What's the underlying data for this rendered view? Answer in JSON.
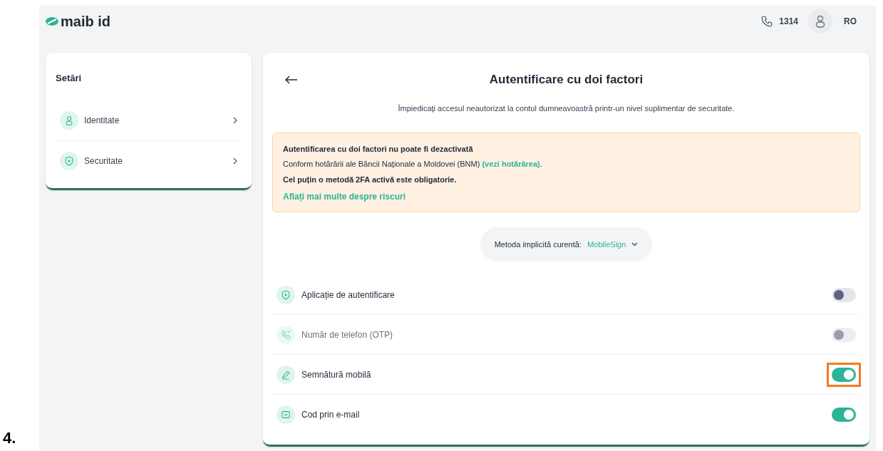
{
  "step_label": "4.",
  "header": {
    "logo": "maib id",
    "phone": "1314",
    "language": "RO"
  },
  "sidebar": {
    "title": "Setări",
    "items": [
      {
        "label": "Identitate",
        "kind": "person"
      },
      {
        "label": "Securitate",
        "kind": "shield"
      }
    ]
  },
  "main": {
    "title": "Autentificare cu doi factori",
    "subtitle": "Împiedicați accesul neautorizat la contul dumneavoastră printr-un nivel suplimentar de securitate.",
    "alert": {
      "title": "Autentificarea cu doi factori nu poate fi dezactivată",
      "text": "Conform hotărârii ale Băncii Naționale a Moldovei (BNM)",
      "link": "(vezi hotărârea)",
      "after_link": ".",
      "emphasis": "Cel puțin o metodă 2FA activă este obligatorie.",
      "more_link": "Aflați mai multe despre riscuri"
    },
    "default_method": {
      "label": "Metoda implicită curentă:",
      "value": "MobileSign"
    },
    "methods": [
      {
        "label": "Aplicație de autentificare",
        "kind": "shield",
        "on": false,
        "disabled": false,
        "highlighted": false
      },
      {
        "label": "Număr de telefon (OTP)",
        "kind": "phone",
        "on": false,
        "disabled": true,
        "highlighted": false
      },
      {
        "label": "Semnătură mobilă",
        "kind": "pen",
        "on": true,
        "disabled": false,
        "highlighted": true
      },
      {
        "label": "Cod prin e-mail",
        "kind": "mail",
        "on": true,
        "disabled": false,
        "highlighted": false
      }
    ]
  }
}
